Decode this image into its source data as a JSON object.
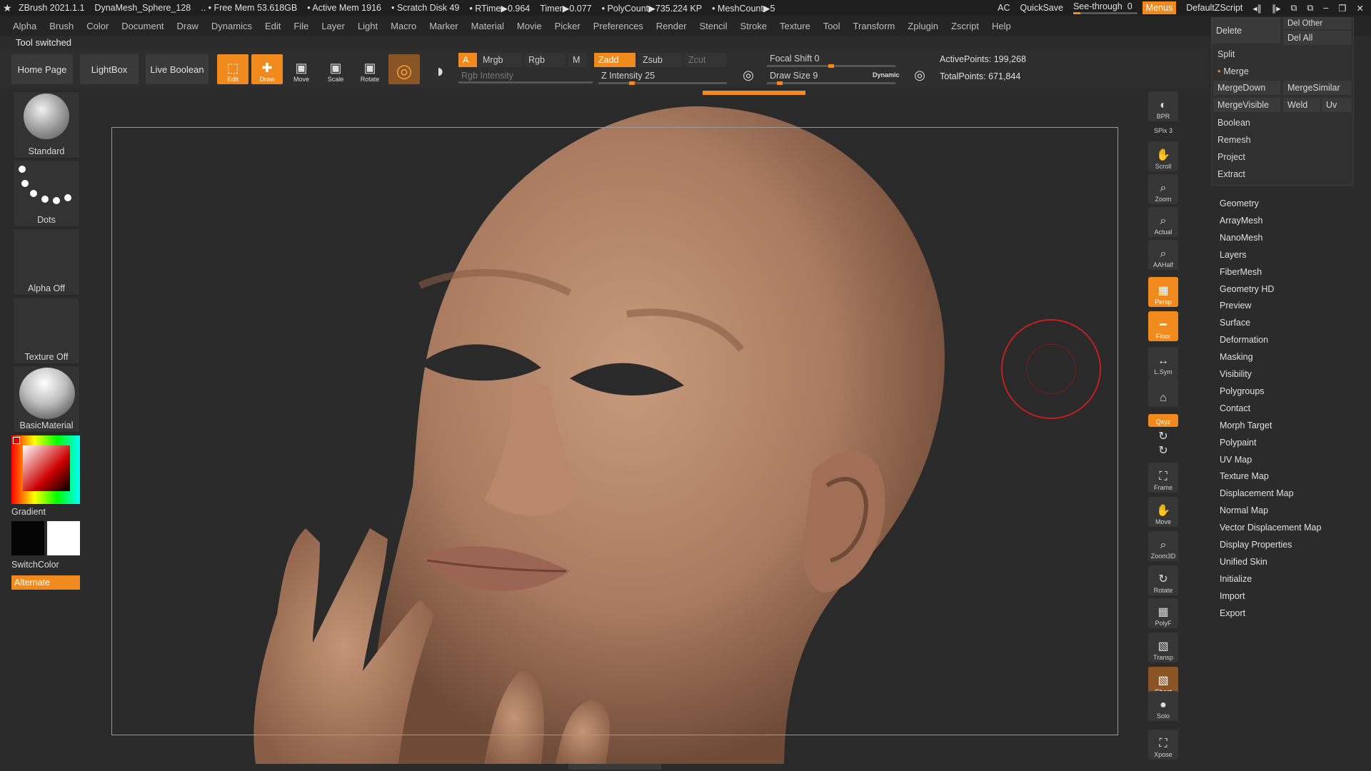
{
  "titlebar": {
    "app": "ZBrush 2021.1.1",
    "tool_name": "DynaMesh_Sphere_128",
    "free_mem": ".. • Free Mem 53.618GB",
    "active_mem": "• Active Mem 1916",
    "scratch": "• Scratch Disk 49",
    "rtime": "• RTime▶0.964",
    "timer": "Timer▶0.077",
    "polycount": "• PolyCount▶735.224 KP",
    "meshcount": "• MeshCount▶5",
    "ac": "AC",
    "quicksave": "QuickSave",
    "seethrough": "See-through",
    "seethrough_value": "0",
    "menus": "Menus",
    "script": "DefaultZScript"
  },
  "menubar": [
    "Alpha",
    "Brush",
    "Color",
    "Document",
    "Draw",
    "Dynamics",
    "Edit",
    "File",
    "Layer",
    "Light",
    "Macro",
    "Marker",
    "Material",
    "Movie",
    "Picker",
    "Preferences",
    "Render",
    "Stencil",
    "Stroke",
    "Texture",
    "Tool",
    "Transform",
    "Zplugin",
    "Zscript",
    "Help"
  ],
  "status": "Tool switched",
  "toolbar": {
    "home": "Home Page",
    "lightbox": "LightBox",
    "liveboolean": "Live Boolean",
    "edit": "Edit",
    "draw": "Draw",
    "move": "Move",
    "scale": "Scale",
    "rotate": "Rotate",
    "a": "A",
    "mrgb": "Mrgb",
    "rgb": "Rgb",
    "m": "M",
    "zadd": "Zadd",
    "zsub": "Zsub",
    "zcut": "Zcut",
    "rgb_intensity": "Rgb Intensity",
    "z_intensity": "Z Intensity 25",
    "focal_shift": "Focal Shift 0",
    "draw_size": "Draw Size 9",
    "dynamic": "Dynamic",
    "active_points": "ActivePoints: 199,268",
    "total_points": "TotalPoints: 671,844",
    "z_intensity_level": 0.25,
    "draw_size_level": 0.08,
    "focal_shift_level": 0.5
  },
  "leftshelf": {
    "brush": "Standard",
    "stroke": "Dots",
    "alpha": "Alpha Off",
    "texture": "Texture Off",
    "material": "BasicMaterial",
    "gradient": "Gradient",
    "switchcolor": "SwitchColor",
    "alternate": "Alternate"
  },
  "righttool": [
    "BPR",
    "SPix 3",
    "Scroll",
    "Zoom",
    "Actual",
    "AAHalf",
    "Persp",
    "Floor",
    "L.Sym",
    "",
    "Qxyz",
    "",
    "",
    "Frame",
    "Move",
    "Zoom3D",
    "Rotate",
    "PolyF",
    "Transp",
    "Ghost",
    "Solo",
    "Xpose"
  ],
  "rpanel": {
    "delete": "Delete",
    "del_other": "Del Other",
    "del_all": "Del All",
    "split": "Split",
    "merge": "Merge",
    "mergedown": "MergeDown",
    "mergesimilar": "MergeSimilar",
    "mergevisible": "MergeVisible",
    "weld": "Weld",
    "uv": "Uv",
    "boolean": "Boolean",
    "remesh": "Remesh",
    "project": "Project",
    "extract": "Extract"
  },
  "subpalettes": [
    "Geometry",
    "ArrayMesh",
    "NanoMesh",
    "Layers",
    "FiberMesh",
    "Geometry HD",
    "Preview",
    "Surface",
    "Deformation",
    "Masking",
    "Visibility",
    "Polygroups",
    "Contact",
    "Morph Target",
    "Polypaint",
    "UV Map",
    "Texture Map",
    "Displacement Map",
    "Normal Map",
    "Vector Displacement Map",
    "Display Properties",
    "Unified Skin",
    "Initialize",
    "Import",
    "Export"
  ],
  "colors": {
    "accent": "#f08a1e",
    "brush_cursor": "#c02020",
    "skin": "#b98a6e"
  }
}
